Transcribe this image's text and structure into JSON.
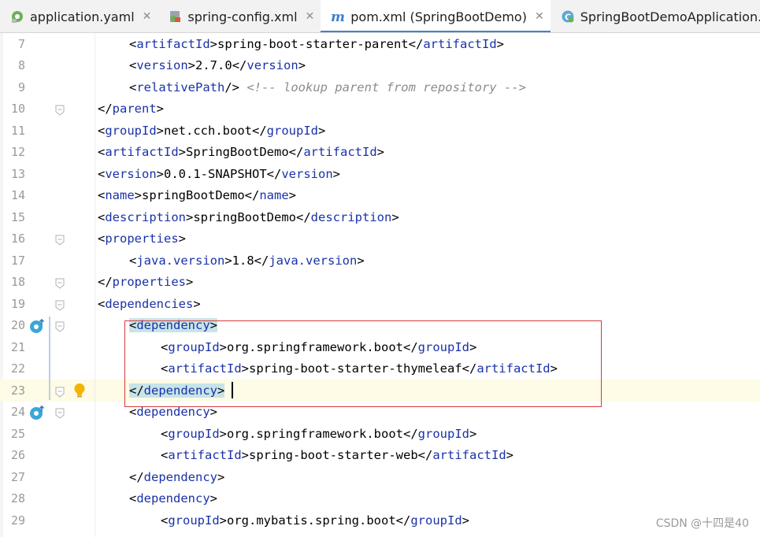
{
  "tabs": [
    {
      "label": "application.yaml",
      "icon": "yaml-file-icon",
      "active": false
    },
    {
      "label": "spring-config.xml",
      "icon": "xml-file-icon",
      "active": false
    },
    {
      "label": "pom.xml (SpringBootDemo)",
      "icon": "maven-file-icon",
      "active": true
    },
    {
      "label": "SpringBootDemoApplication.java",
      "icon": "java-class-icon",
      "active": false
    }
  ],
  "close_glyph": "✕",
  "editor": {
    "lines": [
      {
        "n": "7",
        "indent": 2,
        "tokens": [
          [
            "p",
            "<"
          ],
          [
            "t",
            "artifactId"
          ],
          [
            "p",
            ">"
          ],
          [
            "x",
            "spring-boot-starter-parent"
          ],
          [
            "p",
            "</"
          ],
          [
            "t",
            "artifactId"
          ],
          [
            "p",
            ">"
          ]
        ]
      },
      {
        "n": "8",
        "indent": 2,
        "tokens": [
          [
            "p",
            "<"
          ],
          [
            "t",
            "version"
          ],
          [
            "p",
            ">"
          ],
          [
            "x",
            "2.7.0"
          ],
          [
            "p",
            "</"
          ],
          [
            "t",
            "version"
          ],
          [
            "p",
            ">"
          ]
        ]
      },
      {
        "n": "9",
        "indent": 2,
        "tokens": [
          [
            "p",
            "<"
          ],
          [
            "t",
            "relativePath"
          ],
          [
            "p",
            "/> "
          ],
          [
            "c",
            "<!-- lookup parent from repository -->"
          ]
        ]
      },
      {
        "n": "10",
        "indent": 1,
        "tokens": [
          [
            "p",
            "</"
          ],
          [
            "t",
            "parent"
          ],
          [
            "p",
            ">"
          ]
        ]
      },
      {
        "n": "11",
        "indent": 1,
        "tokens": [
          [
            "p",
            "<"
          ],
          [
            "t",
            "groupId"
          ],
          [
            "p",
            ">"
          ],
          [
            "x",
            "net.cch.boot"
          ],
          [
            "p",
            "</"
          ],
          [
            "t",
            "groupId"
          ],
          [
            "p",
            ">"
          ]
        ]
      },
      {
        "n": "12",
        "indent": 1,
        "tokens": [
          [
            "p",
            "<"
          ],
          [
            "t",
            "artifactId"
          ],
          [
            "p",
            ">"
          ],
          [
            "x",
            "SpringBootDemo"
          ],
          [
            "p",
            "</"
          ],
          [
            "t",
            "artifactId"
          ],
          [
            "p",
            ">"
          ]
        ]
      },
      {
        "n": "13",
        "indent": 1,
        "tokens": [
          [
            "p",
            "<"
          ],
          [
            "t",
            "version"
          ],
          [
            "p",
            ">"
          ],
          [
            "x",
            "0.0.1-SNAPSHOT"
          ],
          [
            "p",
            "</"
          ],
          [
            "t",
            "version"
          ],
          [
            "p",
            ">"
          ]
        ]
      },
      {
        "n": "14",
        "indent": 1,
        "tokens": [
          [
            "p",
            "<"
          ],
          [
            "t",
            "name"
          ],
          [
            "p",
            ">"
          ],
          [
            "x",
            "springBootDemo"
          ],
          [
            "p",
            "</"
          ],
          [
            "t",
            "name"
          ],
          [
            "p",
            ">"
          ]
        ]
      },
      {
        "n": "15",
        "indent": 1,
        "tokens": [
          [
            "p",
            "<"
          ],
          [
            "t",
            "description"
          ],
          [
            "p",
            ">"
          ],
          [
            "x",
            "springBootDemo"
          ],
          [
            "p",
            "</"
          ],
          [
            "t",
            "description"
          ],
          [
            "p",
            ">"
          ]
        ]
      },
      {
        "n": "16",
        "indent": 1,
        "tokens": [
          [
            "p",
            "<"
          ],
          [
            "t",
            "properties"
          ],
          [
            "p",
            ">"
          ]
        ]
      },
      {
        "n": "17",
        "indent": 2,
        "tokens": [
          [
            "p",
            "<"
          ],
          [
            "t",
            "java.version"
          ],
          [
            "p",
            ">"
          ],
          [
            "x",
            "1.8"
          ],
          [
            "p",
            "</"
          ],
          [
            "t",
            "java.version"
          ],
          [
            "p",
            ">"
          ]
        ]
      },
      {
        "n": "18",
        "indent": 1,
        "tokens": [
          [
            "p",
            "</"
          ],
          [
            "t",
            "properties"
          ],
          [
            "p",
            ">"
          ]
        ]
      },
      {
        "n": "19",
        "indent": 1,
        "tokens": [
          [
            "p",
            "<"
          ],
          [
            "t",
            "dependencies"
          ],
          [
            "p",
            ">"
          ]
        ]
      },
      {
        "n": "20",
        "indent": 2,
        "highlight": true,
        "tokens": [
          [
            "p",
            "<"
          ],
          [
            "t",
            "dependency"
          ],
          [
            "p",
            ">"
          ]
        ]
      },
      {
        "n": "21",
        "indent": 3,
        "tokens": [
          [
            "p",
            "<"
          ],
          [
            "t",
            "groupId"
          ],
          [
            "p",
            ">"
          ],
          [
            "x",
            "org.springframework.boot"
          ],
          [
            "p",
            "</"
          ],
          [
            "t",
            "groupId"
          ],
          [
            "p",
            ">"
          ]
        ]
      },
      {
        "n": "22",
        "indent": 3,
        "tokens": [
          [
            "p",
            "<"
          ],
          [
            "t",
            "artifactId"
          ],
          [
            "p",
            ">"
          ],
          [
            "x",
            "spring-boot-starter-thymeleaf"
          ],
          [
            "p",
            "</"
          ],
          [
            "t",
            "artifactId"
          ],
          [
            "p",
            ">"
          ]
        ]
      },
      {
        "n": "23",
        "indent": 2,
        "highlight": true,
        "tokens": [
          [
            "p",
            "</"
          ],
          [
            "t",
            "dependency"
          ],
          [
            "p",
            ">"
          ]
        ]
      },
      {
        "n": "24",
        "indent": 2,
        "tokens": [
          [
            "p",
            "<"
          ],
          [
            "t",
            "dependency"
          ],
          [
            "p",
            ">"
          ]
        ]
      },
      {
        "n": "25",
        "indent": 3,
        "tokens": [
          [
            "p",
            "<"
          ],
          [
            "t",
            "groupId"
          ],
          [
            "p",
            ">"
          ],
          [
            "x",
            "org.springframework.boot"
          ],
          [
            "p",
            "</"
          ],
          [
            "t",
            "groupId"
          ],
          [
            "p",
            ">"
          ]
        ]
      },
      {
        "n": "26",
        "indent": 3,
        "tokens": [
          [
            "p",
            "<"
          ],
          [
            "t",
            "artifactId"
          ],
          [
            "p",
            ">"
          ],
          [
            "x",
            "spring-boot-starter-web"
          ],
          [
            "p",
            "</"
          ],
          [
            "t",
            "artifactId"
          ],
          [
            "p",
            ">"
          ]
        ]
      },
      {
        "n": "27",
        "indent": 2,
        "tokens": [
          [
            "p",
            "</"
          ],
          [
            "t",
            "dependency"
          ],
          [
            "p",
            ">"
          ]
        ]
      },
      {
        "n": "28",
        "indent": 2,
        "tokens": [
          [
            "p",
            "<"
          ],
          [
            "t",
            "dependency"
          ],
          [
            "p",
            ">"
          ]
        ]
      },
      {
        "n": "29",
        "indent": 3,
        "tokens": [
          [
            "p",
            "<"
          ],
          [
            "t",
            "groupId"
          ],
          [
            "p",
            ">"
          ],
          [
            "x",
            "org.mybatis.spring.boot"
          ],
          [
            "p",
            "</"
          ],
          [
            "t",
            "groupId"
          ],
          [
            "p",
            ">"
          ]
        ]
      }
    ]
  },
  "gutter": {
    "fold_lines": [
      "10",
      "16",
      "18",
      "19",
      "20",
      "23",
      "24"
    ],
    "run_icon_lines": [
      "20",
      "24"
    ],
    "intention_bulb_line": "23",
    "caret_line": "23"
  },
  "colors": {
    "tag": "#1a32a8",
    "comment": "#8c8c8c",
    "highlight": "#c7e4e8",
    "caret_line": "#fefbe6",
    "annotation_box": "#d63a3a",
    "active_tab_indicator": "#4083c9"
  },
  "watermark": "CSDN @十四是40"
}
